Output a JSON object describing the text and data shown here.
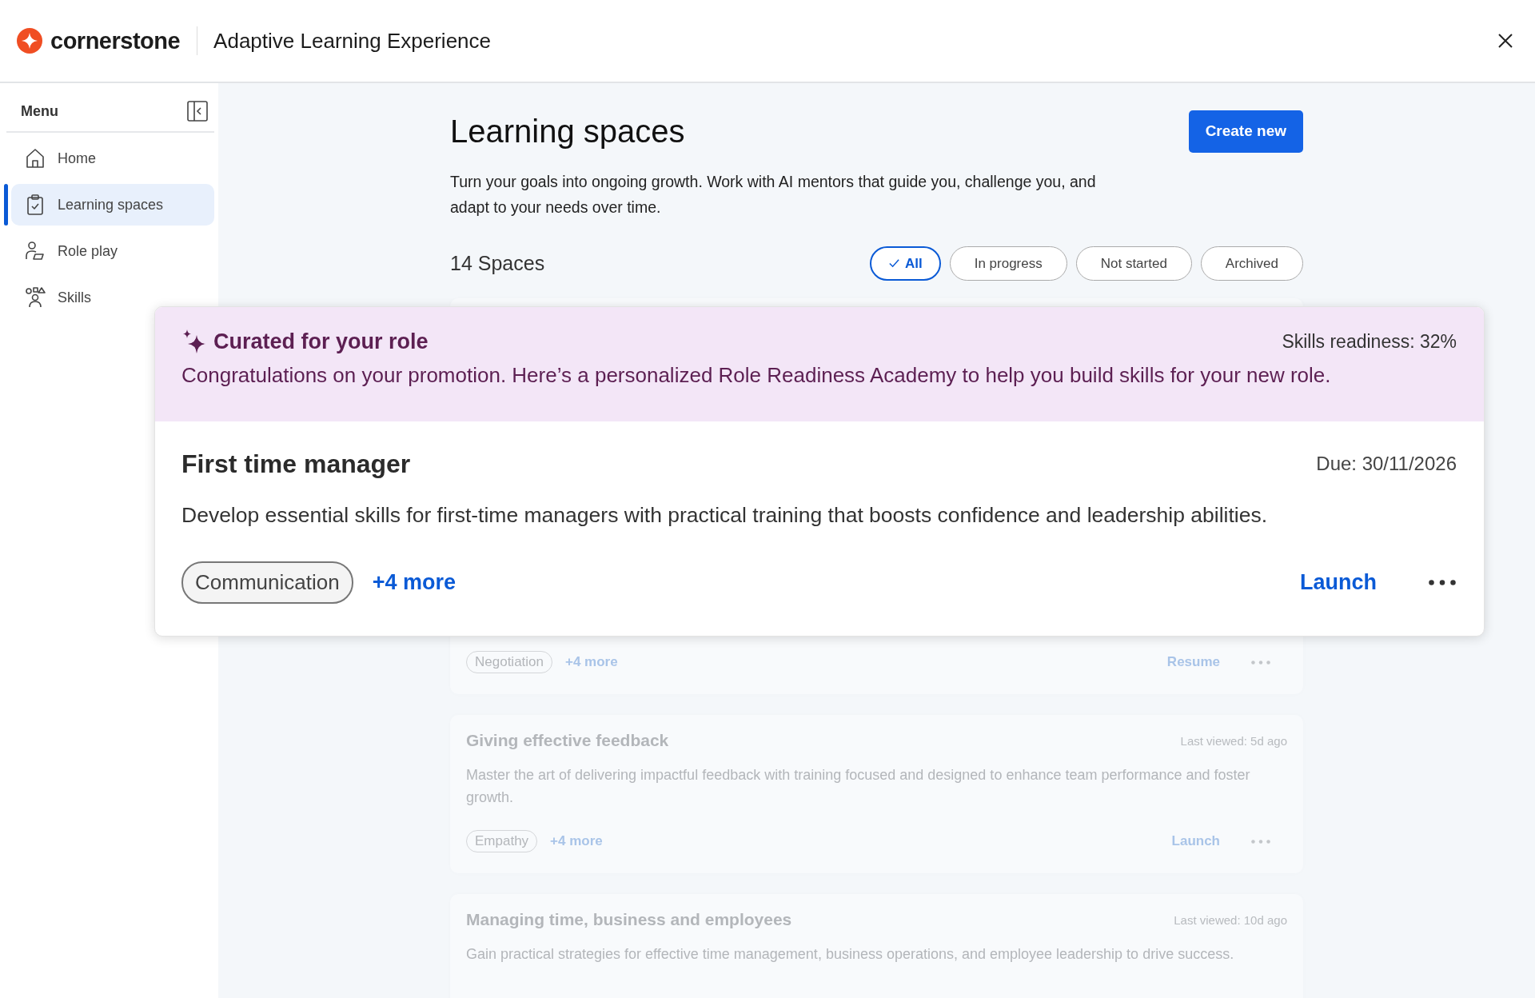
{
  "header": {
    "brand": "cornerstone",
    "title": "Adaptive Learning Experience"
  },
  "sidebar": {
    "title": "Menu",
    "items": [
      {
        "label": "Home",
        "selected": false
      },
      {
        "label": "Learning spaces",
        "selected": true
      },
      {
        "label": "Role play",
        "selected": false
      },
      {
        "label": "Skills",
        "selected": false
      }
    ]
  },
  "page": {
    "title": "Learning spaces",
    "create_button": "Create new",
    "description": "Turn your goals into ongoing growth. Work with AI mentors that guide you, challenge you, and adapt to your needs over time.",
    "count": "14 Spaces"
  },
  "filters": [
    {
      "label": "All",
      "selected": true
    },
    {
      "label": "In progress",
      "selected": false
    },
    {
      "label": "Not started",
      "selected": false
    },
    {
      "label": "Archived",
      "selected": false
    }
  ],
  "featured": {
    "banner_title": "Curated for your role",
    "readiness": "Skills readiness: 32%",
    "banner_text": "Congratulations on your promotion. Here’s a personalized Role Readiness Academy to help you build skills for your new role.",
    "title": "First time manager",
    "due": "Due: 30/11/2026",
    "description": "Develop essential skills for first-time managers with practical training that boosts confidence and leadership abilities.",
    "tag": "Communication",
    "more": "+4 more",
    "action": "Launch"
  },
  "spaces": [
    {
      "tag": "Negotiation",
      "more": "+4 more",
      "action": "Resume"
    },
    {
      "title": "Giving effective feedback",
      "meta": "Last viewed: 5d ago",
      "description": "Master the art of delivering impactful feedback with training focused and designed to enhance team performance and foster growth.",
      "tag": "Empathy",
      "more": "+4 more",
      "action": "Launch"
    },
    {
      "title": "Managing time, business and employees",
      "meta": "Last viewed: 10d ago",
      "description": "Gain practical strategies for effective time management, business operations, and employee leadership to drive success."
    }
  ]
}
